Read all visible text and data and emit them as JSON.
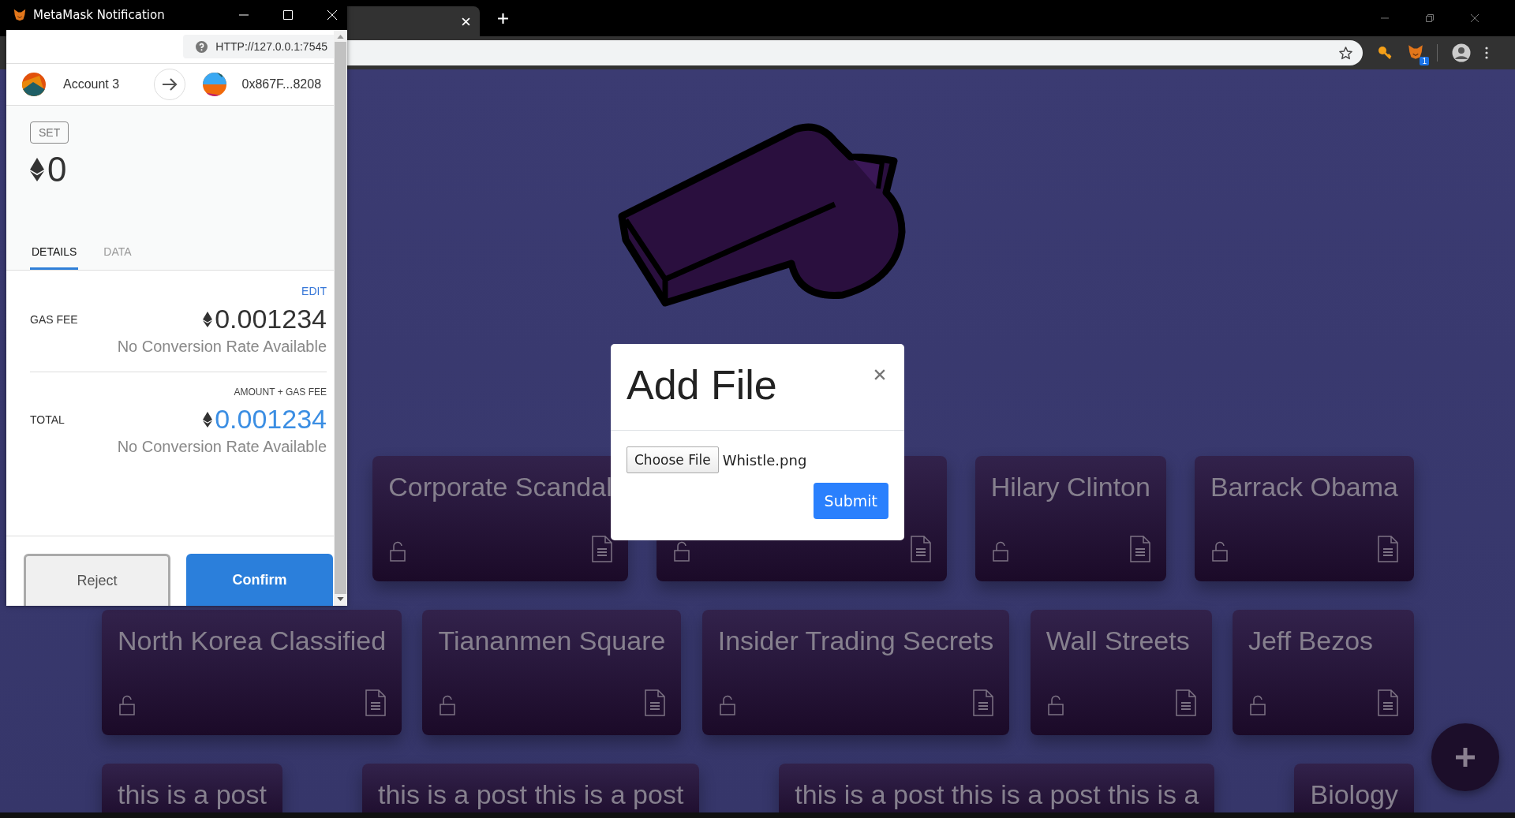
{
  "browser": {
    "extension_badge": "1"
  },
  "popup": {
    "title": "MetaMask Notification",
    "origin": "HTTP://127.0.0.1:7545",
    "from_account": "Account 3",
    "to_address": "0x867F...8208",
    "method": "SET",
    "amount": "0",
    "tabs": [
      {
        "label": "DETAILS",
        "selected": true
      },
      {
        "label": "DATA",
        "selected": false
      }
    ],
    "fees": [
      {
        "label": "GAS FEE",
        "caption": "EDIT",
        "kind": "link",
        "value": "0.001234",
        "conversion": "No Conversion Rate Available",
        "highlight": false
      },
      {
        "label": "TOTAL",
        "caption": "AMOUNT + GAS FEE",
        "kind": "note",
        "value": "0.001234",
        "conversion": "No Conversion Rate Available",
        "highlight": true
      }
    ],
    "buttons": [
      {
        "label": "Reject",
        "kind": "secondary"
      },
      {
        "label": "Confirm",
        "kind": "primary"
      }
    ]
  },
  "card_rows": [
    {
      "kind": "full",
      "cards": [
        {
          "title": "Corporate Scandal"
        },
        {
          "kind": "covered"
        },
        {
          "title": "Hilary Clinton"
        },
        {
          "title": "Barrack Obama"
        }
      ]
    },
    {
      "kind": "full",
      "cards": [
        {
          "title": "North Korea Classified"
        },
        {
          "title": "Tiananmen Square"
        },
        {
          "title": "Insider Trading Secrets"
        },
        {
          "title": "Wall Streets"
        },
        {
          "title": "Jeff Bezos"
        }
      ]
    },
    {
      "kind": "cut",
      "cards": [
        {
          "title": "this is a post"
        },
        {
          "title": "this is a post this is a post"
        },
        {
          "title": "this is a post this is a post this is a"
        },
        {
          "title": "Biology"
        }
      ]
    }
  ],
  "modal": {
    "title": "Add File",
    "choose_button": "Choose File",
    "file_name": "Whistle.png",
    "submit": "Submit"
  }
}
